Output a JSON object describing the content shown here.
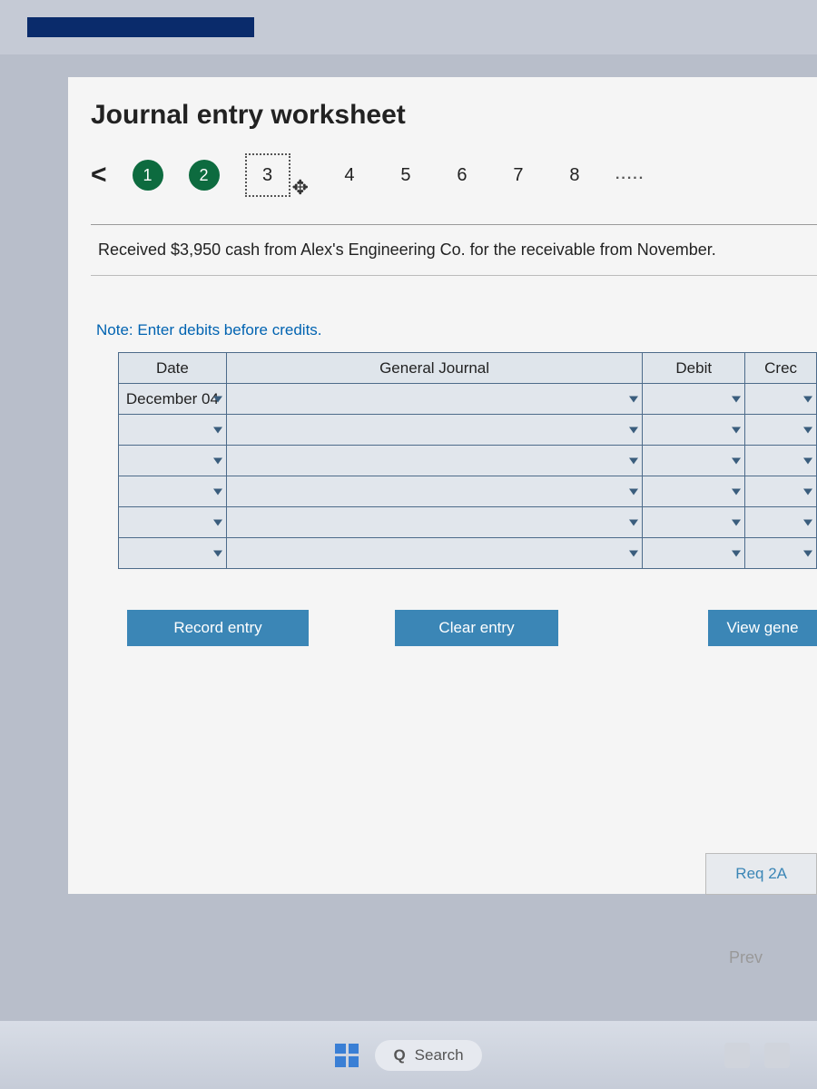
{
  "header": {
    "title": "Journal entry worksheet"
  },
  "stepper": {
    "chev": "<",
    "s1": "1",
    "s2": "2",
    "s3": "3",
    "s4": "4",
    "s5": "5",
    "s6": "6",
    "s7": "7",
    "s8": "8",
    "more": "....."
  },
  "prompt": "Received $3,950 cash from Alex's Engineering Co. for the receivable from November.",
  "note": "Note: Enter debits before credits.",
  "table": {
    "h_date": "Date",
    "h_gj": "General Journal",
    "h_debit": "Debit",
    "h_credit": "Crec",
    "row1_date": "December 04"
  },
  "buttons": {
    "record": "Record entry",
    "clear": "Clear entry",
    "view": "View gene",
    "req": "Req 2A",
    "prev": "Prev"
  },
  "taskbar": {
    "search": "Search"
  }
}
